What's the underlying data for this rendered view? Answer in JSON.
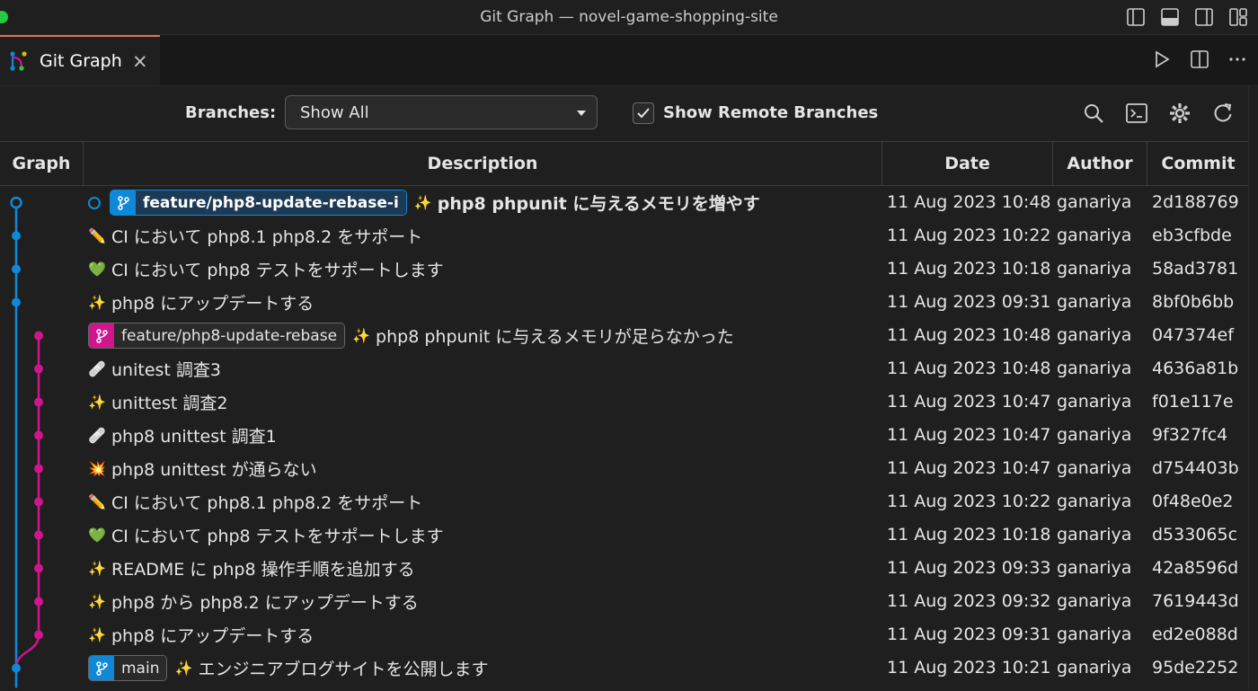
{
  "window": {
    "title": "Git Graph — novel-game-shopping-site"
  },
  "tab": {
    "label": "Git Graph",
    "close": "×"
  },
  "controls": {
    "branches_label": "Branches:",
    "branches_value": "Show All",
    "remote_label": "Show Remote Branches",
    "remote_checked": true
  },
  "columns": {
    "graph": "Graph",
    "description": "Description",
    "date": "Date",
    "author": "Author",
    "commit": "Commit"
  },
  "colors": {
    "branch_blue": "#0f88d8",
    "branch_pink": "#d0168d",
    "tab_accent": "#e66f4d"
  },
  "rows": [
    {
      "emoji": "✨",
      "ref": "feature/php8-update-rebase-i",
      "message": "php8 phpunit に与えるメモリを増やす",
      "date": "11 Aug 2023 10:48",
      "author": "ganariya",
      "commit": "2d188769"
    },
    {
      "emoji": "✏️",
      "message": "CI において php8.1 php8.2 をサポート",
      "date": "11 Aug 2023 10:22",
      "author": "ganariya",
      "commit": "eb3cfbde"
    },
    {
      "emoji": "💚",
      "message": "CI において php8 テストをサポートします",
      "date": "11 Aug 2023 10:18",
      "author": "ganariya",
      "commit": "58ad3781"
    },
    {
      "emoji": "✨",
      "message": "php8 にアップデートする",
      "date": "11 Aug 2023 09:31",
      "author": "ganariya",
      "commit": "8bf0b6bb"
    },
    {
      "emoji": "✨",
      "ref": "feature/php8-update-rebase",
      "message": "php8 phpunit に与えるメモリが足らなかった",
      "date": "11 Aug 2023 10:48",
      "author": "ganariya",
      "commit": "047374ef"
    },
    {
      "emoji": "🩹",
      "message": "unitest 調査3",
      "date": "11 Aug 2023 10:48",
      "author": "ganariya",
      "commit": "4636a81b"
    },
    {
      "emoji": "✨",
      "message": "unittest 調査2",
      "date": "11 Aug 2023 10:47",
      "author": "ganariya",
      "commit": "f01e117e"
    },
    {
      "emoji": "🩹",
      "message": "php8 unittest 調査1",
      "date": "11 Aug 2023 10:47",
      "author": "ganariya",
      "commit": "9f327fc4"
    },
    {
      "emoji": "💥",
      "message": "php8 unittest が通らない",
      "date": "11 Aug 2023 10:47",
      "author": "ganariya",
      "commit": "d754403b"
    },
    {
      "emoji": "✏️",
      "message": "CI において php8.1 php8.2 をサポート",
      "date": "11 Aug 2023 10:22",
      "author": "ganariya",
      "commit": "0f48e0e2"
    },
    {
      "emoji": "💚",
      "message": "CI において php8 テストをサポートします",
      "date": "11 Aug 2023 10:18",
      "author": "ganariya",
      "commit": "d533065c"
    },
    {
      "emoji": "✨",
      "message": "README に php8 操作手順を追加する",
      "date": "11 Aug 2023 09:33",
      "author": "ganariya",
      "commit": "42a8596d"
    },
    {
      "emoji": "✨",
      "message": "php8 から php8.2 にアップデートする",
      "date": "11 Aug 2023 09:32",
      "author": "ganariya",
      "commit": "7619443d"
    },
    {
      "emoji": "✨",
      "message": "php8 にアップデートする",
      "date": "11 Aug 2023 09:31",
      "author": "ganariya",
      "commit": "ed2e088d"
    },
    {
      "emoji": "✨",
      "ref": "main",
      "message": "エンジニアブログサイトを公開します",
      "date": "11 Aug 2023 10:21",
      "author": "ganariya",
      "commit": "95de2252"
    }
  ]
}
